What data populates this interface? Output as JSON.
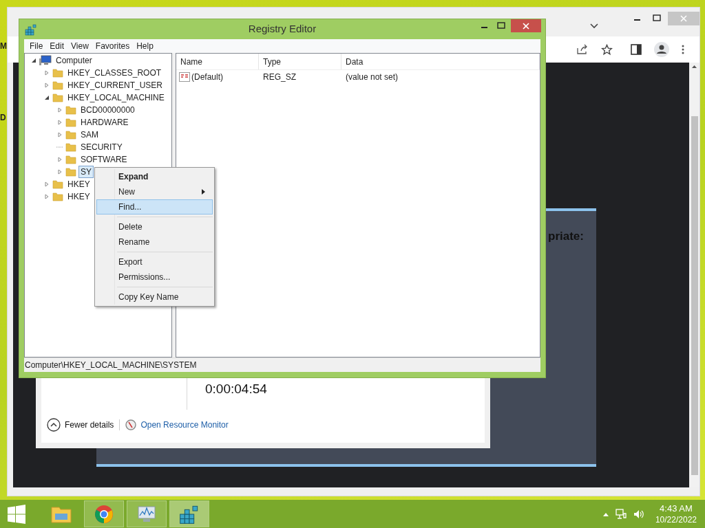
{
  "desktop": {
    "icon_labels": [
      "M",
      "D"
    ]
  },
  "browser": {
    "back_panel": {
      "text": "priate:"
    },
    "task_manager": {
      "elapsed": "0:00:04:54",
      "fewer_details": "Fewer details",
      "resource_monitor_link": "Open Resource Monitor"
    }
  },
  "regedit": {
    "title": "Registry Editor",
    "menu": [
      "File",
      "Edit",
      "View",
      "Favorites",
      "Help"
    ],
    "tree": [
      {
        "label": "Computer",
        "kind": "computer",
        "expanded": true,
        "selected": false,
        "children": [
          {
            "label": "HKEY_CLASSES_ROOT",
            "kind": "folder",
            "expanded": false,
            "selected": false
          },
          {
            "label": "HKEY_CURRENT_USER",
            "kind": "folder",
            "expanded": false,
            "selected": false
          },
          {
            "label": "HKEY_LOCAL_MACHINE",
            "kind": "folder",
            "expanded": true,
            "selected": false,
            "children": [
              {
                "label": "BCD00000000",
                "kind": "folder",
                "expanded": false,
                "selected": false
              },
              {
                "label": "HARDWARE",
                "kind": "folder",
                "expanded": false,
                "selected": false
              },
              {
                "label": "SAM",
                "kind": "folder",
                "expanded": false,
                "selected": false
              },
              {
                "label": "SECURITY",
                "kind": "leaf",
                "selected": false
              },
              {
                "label": "SOFTWARE",
                "kind": "folder",
                "expanded": false,
                "selected": false
              },
              {
                "label": "SY",
                "kind": "folder",
                "expanded": false,
                "selected": true
              }
            ]
          },
          {
            "label": "HKEY",
            "kind": "folder",
            "expanded": false,
            "selected": false
          },
          {
            "label": "HKEY",
            "kind": "folder",
            "expanded": false,
            "selected": false
          }
        ]
      }
    ],
    "columns": [
      "Name",
      "Type",
      "Data"
    ],
    "rows": [
      {
        "name": "(Default)",
        "type": "REG_SZ",
        "data": "(value not set)"
      }
    ],
    "status": "Computer\\HKEY_LOCAL_MACHINE\\SYSTEM"
  },
  "context_menu": {
    "items": [
      {
        "kind": "item",
        "label": "Expand",
        "bold": true,
        "submenu": false,
        "selected": false
      },
      {
        "kind": "item",
        "label": "New",
        "bold": false,
        "submenu": true,
        "selected": false
      },
      {
        "kind": "item",
        "label": "Find...",
        "bold": false,
        "submenu": false,
        "selected": true
      },
      {
        "kind": "separator"
      },
      {
        "kind": "item",
        "label": "Delete",
        "bold": false,
        "submenu": false,
        "selected": false
      },
      {
        "kind": "item",
        "label": "Rename",
        "bold": false,
        "submenu": false,
        "selected": false
      },
      {
        "kind": "separator"
      },
      {
        "kind": "item",
        "label": "Export",
        "bold": false,
        "submenu": false,
        "selected": false
      },
      {
        "kind": "item",
        "label": "Permissions...",
        "bold": false,
        "submenu": false,
        "selected": false
      },
      {
        "kind": "separator"
      },
      {
        "kind": "item",
        "label": "Copy Key Name",
        "bold": false,
        "submenu": false,
        "selected": false
      }
    ]
  },
  "taskbar": {
    "apps": [
      {
        "kind": "explorer",
        "running": false,
        "selected": false
      },
      {
        "kind": "chrome",
        "running": true,
        "selected": false
      },
      {
        "kind": "monitor",
        "running": true,
        "selected": false
      },
      {
        "kind": "regedit",
        "running": true,
        "selected": true
      }
    ],
    "time": "4:43 AM",
    "date": "10/22/2022"
  }
}
